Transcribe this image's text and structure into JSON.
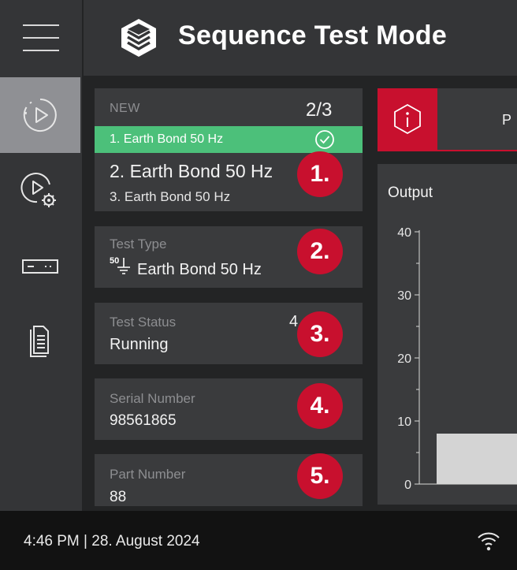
{
  "header": {
    "title": "Sequence Test Mode",
    "menu_icon": "hamburger-icon",
    "logo_icon": "cube-logo-icon"
  },
  "sidebar": {
    "items": [
      {
        "icon": "play-circle-icon",
        "active": true
      },
      {
        "icon": "play-settings-icon",
        "active": false
      },
      {
        "icon": "device-icon",
        "active": false
      },
      {
        "icon": "documents-icon",
        "active": false
      }
    ]
  },
  "sequence": {
    "status_label": "NEW",
    "progress": "2/3",
    "steps": [
      {
        "text": "1. Earth Bond 50 Hz",
        "done": true
      },
      {
        "text": "2. Earth Bond 50 Hz",
        "current": true
      },
      {
        "text": "3. Earth Bond 50 Hz"
      }
    ]
  },
  "test_type": {
    "label": "Test Type",
    "icon_text": "50",
    "value": "Earth Bond 50 Hz"
  },
  "test_status": {
    "label": "Test Status",
    "value": "Running",
    "partial_number": "4"
  },
  "serial": {
    "label": "Serial Number",
    "value": "98561865"
  },
  "part": {
    "label": "Part Number",
    "value": "88"
  },
  "callouts": [
    "1.",
    "2.",
    "3.",
    "4.",
    "5."
  ],
  "info_panel": {
    "icon": "info-hexagon-icon",
    "text_partial": "P"
  },
  "chart_data": {
    "type": "bar",
    "title": "Output",
    "ylim": [
      0,
      40
    ],
    "yticks": [
      0,
      10,
      20,
      30,
      40
    ],
    "values": [
      8
    ]
  },
  "footer": {
    "datetime": "4:46 PM | 28. August 2024",
    "wifi_icon": "wifi-icon"
  },
  "colors": {
    "accent_red": "#c8102e",
    "success_green": "#4cc07a",
    "panel": "#3a3b3d",
    "sidebar_active": "#8f9094"
  }
}
